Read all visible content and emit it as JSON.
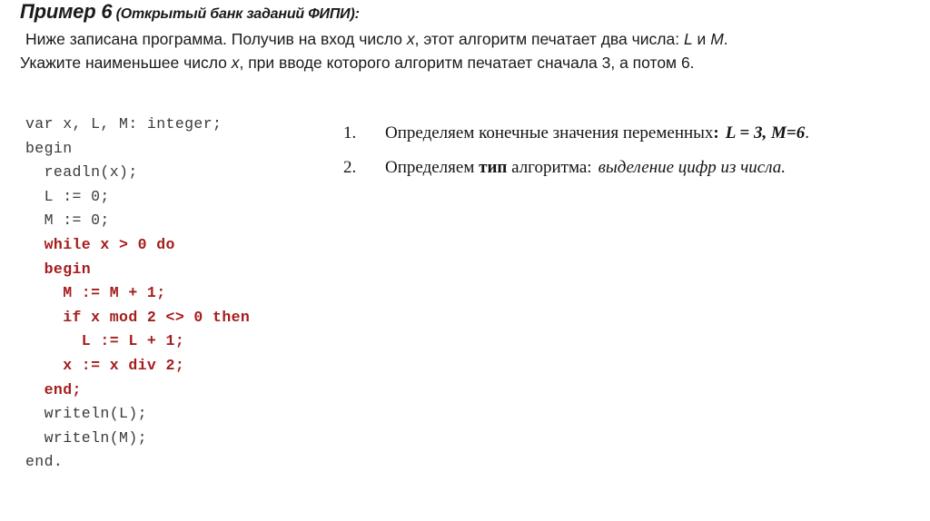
{
  "slide": {
    "title_main": "Пример 6",
    "title_sub": " (Открытый банк заданий ФИПИ):",
    "statement": {
      "line1": "Ниже записана программа. Получив на вход число ",
      "line1_var": "x",
      "line1_cont": ", этот алгоритм печатает два",
      "line2_a": "числа: ",
      "line2_varL": "L",
      "line2_b": " и ",
      "line2_varM": "M",
      "line2_c": ". Укажите наименьшее число ",
      "line2_varx": "x",
      "line2_d": ", при вводе которого алгоритм печатает",
      "line3": "сначала 3, а потом 6."
    }
  },
  "code": {
    "language": "pascal",
    "keyword_color": "#a51c1c",
    "text_color": "#3a3a3a",
    "lines": [
      {
        "text": "var x, L, M: integer;",
        "highlight": false
      },
      {
        "text": "begin",
        "highlight": false
      },
      {
        "text": "  readln(x);",
        "highlight": false
      },
      {
        "text": "  L := 0;",
        "highlight": false
      },
      {
        "text": "  M := 0;",
        "highlight": false
      },
      {
        "text": "  while x > 0 do",
        "highlight": true
      },
      {
        "text": "  begin",
        "highlight": true
      },
      {
        "text": "    M := M + 1;",
        "highlight": true
      },
      {
        "text": "    if x mod 2 <> 0 then",
        "highlight": true
      },
      {
        "text": "      L := L + 1;",
        "highlight": true
      },
      {
        "text": "    x := x div 2;",
        "highlight": true
      },
      {
        "text": "  end;",
        "highlight": true
      },
      {
        "text": "  writeln(L);",
        "highlight": false
      },
      {
        "text": "  writeln(M);",
        "highlight": false
      },
      {
        "text": "end.",
        "highlight": false
      }
    ]
  },
  "steps": {
    "items": [
      {
        "number": "1.",
        "lead": "Определяем конечные значения переменных",
        "colon": ":",
        "result_L": "L = 3,",
        "result_M": "M=6",
        "period": "."
      },
      {
        "number": "2.",
        "lead_a": "Определяем ",
        "bold_word": "тип",
        "lead_b": " алгоритма:",
        "answer": "выделение цифр из числа."
      }
    ]
  }
}
